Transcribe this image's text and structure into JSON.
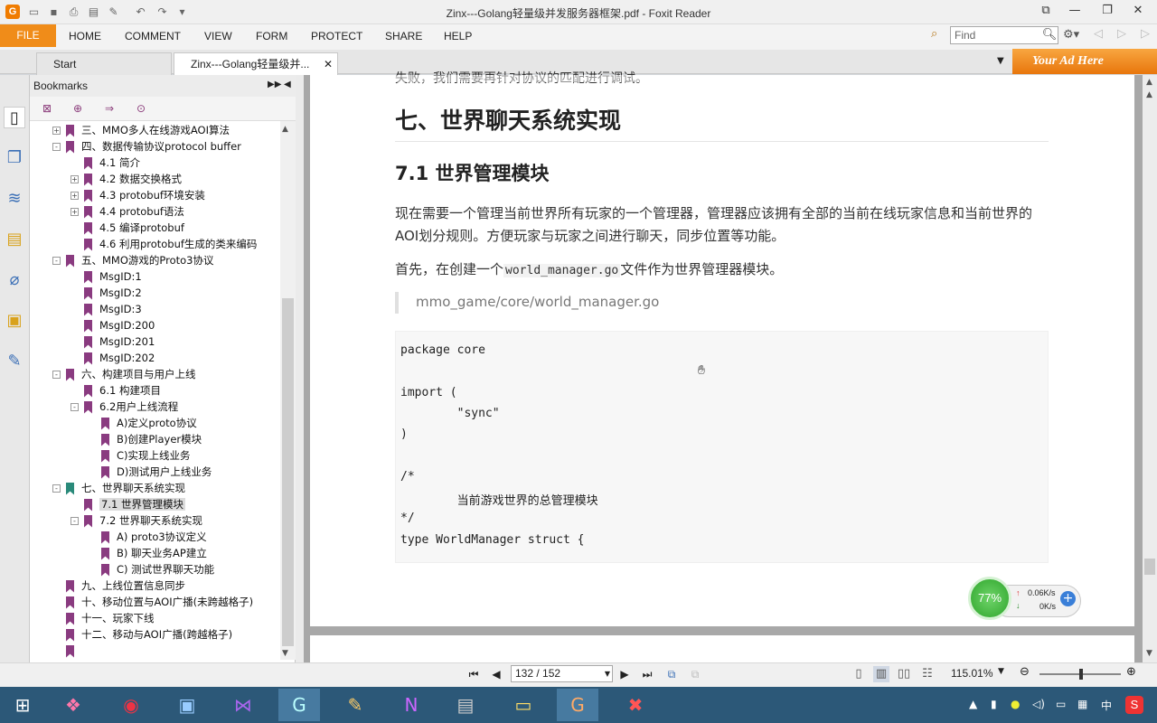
{
  "window": {
    "title": "Zinx---Golang轻量级并发服务器框架.pdf - Foxit Reader",
    "app_icon": "G",
    "controls": [
      "restore-down",
      "minimize",
      "maximize",
      "close"
    ]
  },
  "quick_access": [
    "open-icon",
    "save-icon",
    "print-icon",
    "properties-icon",
    "new-icon",
    "undo-icon",
    "redo-icon",
    "customize-icon"
  ],
  "ribbon": {
    "file_label": "FILE",
    "tabs": [
      "HOME",
      "COMMENT",
      "VIEW",
      "FORM",
      "PROTECT",
      "SHARE",
      "HELP"
    ],
    "find_placeholder": "Find"
  },
  "doc_tabs": [
    {
      "label": "Start"
    },
    {
      "label": "Zinx---Golang轻量级并..."
    }
  ],
  "ad_text": "Your Ad Here",
  "bookmarks": {
    "title": "Bookmarks",
    "items": [
      {
        "label": "三、MMO多人在线游戏AOI算法",
        "level": 0,
        "expander": "+"
      },
      {
        "label": "四、数据传输协议protocol buffer",
        "level": 0,
        "expander": "-"
      },
      {
        "label": "4.1 简介",
        "level": 1,
        "expander": ""
      },
      {
        "label": "4.2 数据交换格式",
        "level": 1,
        "expander": "+"
      },
      {
        "label": "4.3 protobuf环境安装",
        "level": 1,
        "expander": "+"
      },
      {
        "label": "4.4 protobuf语法",
        "level": 1,
        "expander": "+"
      },
      {
        "label": "4.5 编译protobuf",
        "level": 1,
        "expander": ""
      },
      {
        "label": "4.6 利用protobuf生成的类来编码",
        "level": 1,
        "expander": ""
      },
      {
        "label": "五、MMO游戏的Proto3协议",
        "level": 0,
        "expander": "-"
      },
      {
        "label": "MsgID:1",
        "level": 1,
        "expander": ""
      },
      {
        "label": "MsgID:2",
        "level": 1,
        "expander": ""
      },
      {
        "label": "MsgID:3",
        "level": 1,
        "expander": ""
      },
      {
        "label": "MsgID:200",
        "level": 1,
        "expander": ""
      },
      {
        "label": "MsgID:201",
        "level": 1,
        "expander": ""
      },
      {
        "label": "MsgID:202",
        "level": 1,
        "expander": ""
      },
      {
        "label": "六、构建项目与用户上线",
        "level": 0,
        "expander": "-"
      },
      {
        "label": "6.1 构建项目",
        "level": 1,
        "expander": ""
      },
      {
        "label": "6.2用户上线流程",
        "level": 1,
        "expander": "-"
      },
      {
        "label": "A)定义proto协议",
        "level": 2,
        "expander": ""
      },
      {
        "label": "B)创建Player模块",
        "level": 2,
        "expander": ""
      },
      {
        "label": "C)实现上线业务",
        "level": 2,
        "expander": ""
      },
      {
        "label": "D)测试用户上线业务",
        "level": 2,
        "expander": ""
      },
      {
        "label": "七、世界聊天系统实现",
        "level": 0,
        "expander": "-",
        "color": "green"
      },
      {
        "label": "7.1 世界管理模块",
        "level": 1,
        "expander": "",
        "selected": true
      },
      {
        "label": "7.2 世界聊天系统实现",
        "level": 1,
        "expander": "-"
      },
      {
        "label": "A) proto3协议定义",
        "level": 2,
        "expander": ""
      },
      {
        "label": "B) 聊天业务AP建立",
        "level": 2,
        "expander": ""
      },
      {
        "label": "C) 测试世界聊天功能",
        "level": 2,
        "expander": ""
      },
      {
        "label": "九、上线位置信息同步",
        "level": 0,
        "expander": ""
      },
      {
        "label": "十、移动位置与AOI广播(未跨越格子)",
        "level": 0,
        "expander": ""
      },
      {
        "label": "十一、玩家下线",
        "level": 0,
        "expander": ""
      },
      {
        "label": "十二、移动与AOI广播(跨越格子)",
        "level": 0,
        "expander": ""
      },
      {
        "label": "",
        "level": 0,
        "expander": ""
      }
    ]
  },
  "document": {
    "prev_line": "失败，我们需要再针对协议的匹配进行调试。",
    "heading1": "七、世界聊天系统实现",
    "heading2": "7.1 世界管理模块",
    "para1": "现在需要一个管理当前世界所有玩家的一个管理器，管理器应该拥有全部的当前在线玩家信息和当前世界的AOI划分规则。方便玩家与玩家之间进行聊天，同步位置等功能。",
    "para2_pre": "首先，在创建一个",
    "para2_code": "world_manager.go",
    "para2_post": "文件作为世界管理器模块。",
    "quote": "mmo_game/core/world_manager.go",
    "code_lines": [
      "package core",
      "",
      "import (",
      "        \"sync\"",
      ")",
      "",
      "/*",
      "        当前游戏世界的总管理模块",
      "*/",
      "type WorldManager struct {"
    ]
  },
  "net_widget": {
    "percent": "77%",
    "up": "0.06K/s",
    "down": "0K/s"
  },
  "status": {
    "page": "132 / 152",
    "zoom": "115.01%"
  },
  "taskbar": {
    "apps": [
      "windows-start",
      "colorful-app",
      "chrome",
      "network-app",
      "visual-studio",
      "goland",
      "paint-app",
      "onenote",
      "pdf-app",
      "file-explorer",
      "foxit-reader",
      "xmind"
    ],
    "ime": "中",
    "tray_app": "S"
  }
}
